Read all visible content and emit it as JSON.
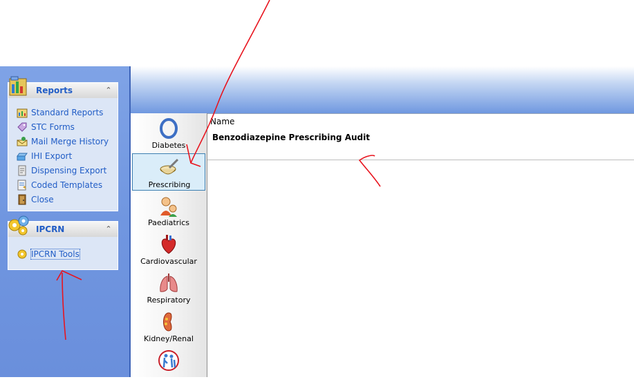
{
  "sidebar": {
    "reports_panel": {
      "title": "Reports",
      "items": [
        {
          "label": "Standard Reports",
          "icon": "bar-chart-icon"
        },
        {
          "label": "STC Forms",
          "icon": "tag-icon"
        },
        {
          "label": "Mail Merge History",
          "icon": "mail-merge-icon"
        },
        {
          "label": "IHI Export",
          "icon": "export-icon"
        },
        {
          "label": "Dispensing Export",
          "icon": "dispensing-icon"
        },
        {
          "label": "Coded Templates",
          "icon": "template-icon"
        },
        {
          "label": "Close",
          "icon": "door-icon"
        }
      ]
    },
    "ipcrn_panel": {
      "title": "IPCRN",
      "items": [
        {
          "label": "IPCRN Tools",
          "icon": "gear-icon"
        }
      ]
    }
  },
  "categories": [
    {
      "label": "Diabetes",
      "icon": "ring-icon",
      "selected": false
    },
    {
      "label": "Prescribing",
      "icon": "mortar-pestle-icon",
      "selected": true
    },
    {
      "label": "Paediatrics",
      "icon": "child-icon",
      "selected": false
    },
    {
      "label": "Cardiovascular",
      "icon": "heart-icon",
      "selected": false
    },
    {
      "label": "Respiratory",
      "icon": "lungs-icon",
      "selected": false
    },
    {
      "label": "Kidney/Renal",
      "icon": "kidney-icon",
      "selected": false
    },
    {
      "label": "",
      "icon": "elderly-icon",
      "selected": false
    }
  ],
  "content": {
    "column_header": "Name",
    "rows": [
      {
        "name": "Benzodiazepine Prescribing Audit"
      }
    ]
  },
  "colors": {
    "link_blue": "#215dc6",
    "sidebar_bg": "#7096e0",
    "selection_bg": "#daedf9",
    "annotation_red": "#e8141e"
  }
}
